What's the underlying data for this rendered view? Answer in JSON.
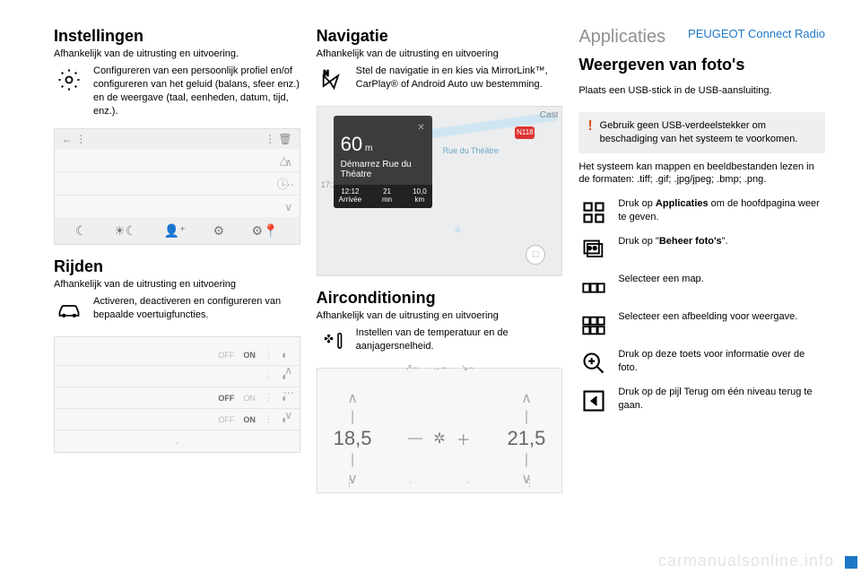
{
  "breadcrumb": "PEUGEOT Connect Radio",
  "col1": {
    "settings": {
      "title": "Instellingen",
      "sub": "Afhankelijk van de uitrusting en uitvoering.",
      "desc": "Configureren van een persoonlijk profiel en/of configureren van het geluid (balans, sfeer enz.) en de weergave (taal, eenheden, datum, tijd, enz.)."
    },
    "driving": {
      "title": "Rijden",
      "sub": "Afhankelijk van de uitrusting en uitvoering",
      "desc": "Activeren, deactiveren en configureren van bepaalde voertuigfuncties."
    }
  },
  "col2": {
    "nav": {
      "title": "Navigatie",
      "sub": "Afhankelijk van de uitrusting en uitvoering",
      "desc": "Stel de navigatie in en kies via MirrorLink™, CarPlay® of Android Auto uw bestemming.",
      "card": {
        "dist": "60",
        "unit": "m",
        "street": "Démarrez Rue du Théatre",
        "arr": "12:12",
        "arrl": "Arrivée",
        "min": "21",
        "minl": "mn",
        "km": "10,0",
        "kml": "km"
      },
      "clock": "17:10",
      "pin": "N118",
      "road": "Rue du Théâtre",
      "cast": "Cast"
    },
    "ac": {
      "title": "Airconditioning",
      "sub": "Afhankelijk van de uitrusting en uitvoering",
      "desc": "Instellen van de temperatuur en de aanjagersnelheid.",
      "left": "18,5",
      "right": "21,5"
    }
  },
  "col3": {
    "apps": "Applicaties",
    "photos": "Weergeven van foto's",
    "usb": "Plaats een USB-stick in de USB-aansluiting.",
    "warn": "Gebruik geen USB-verdeelstekker om beschadiging van het systeem te voorkomen.",
    "formats": "Het systeem kan mappen en beeldbestanden lezen in de formaten: .tiff; .gif; .jpg/jpeg; .bmp; .png.",
    "r1a": "Druk op ",
    "r1b": "Applicaties",
    "r1c": " om de hoofdpagina weer te geven.",
    "r2a": "Druk op \"",
    "r2b": "Beheer foto's",
    "r2c": "\".",
    "r3": "Selecteer een map.",
    "r4": "Selecteer een afbeelding voor weergave.",
    "r5": "Druk op deze toets voor informatie over de foto.",
    "r6": "Druk op de pijl Terug om één niveau terug te gaan."
  },
  "watermark": "carmanualsonline.info",
  "off": "OFF",
  "on": "ON"
}
